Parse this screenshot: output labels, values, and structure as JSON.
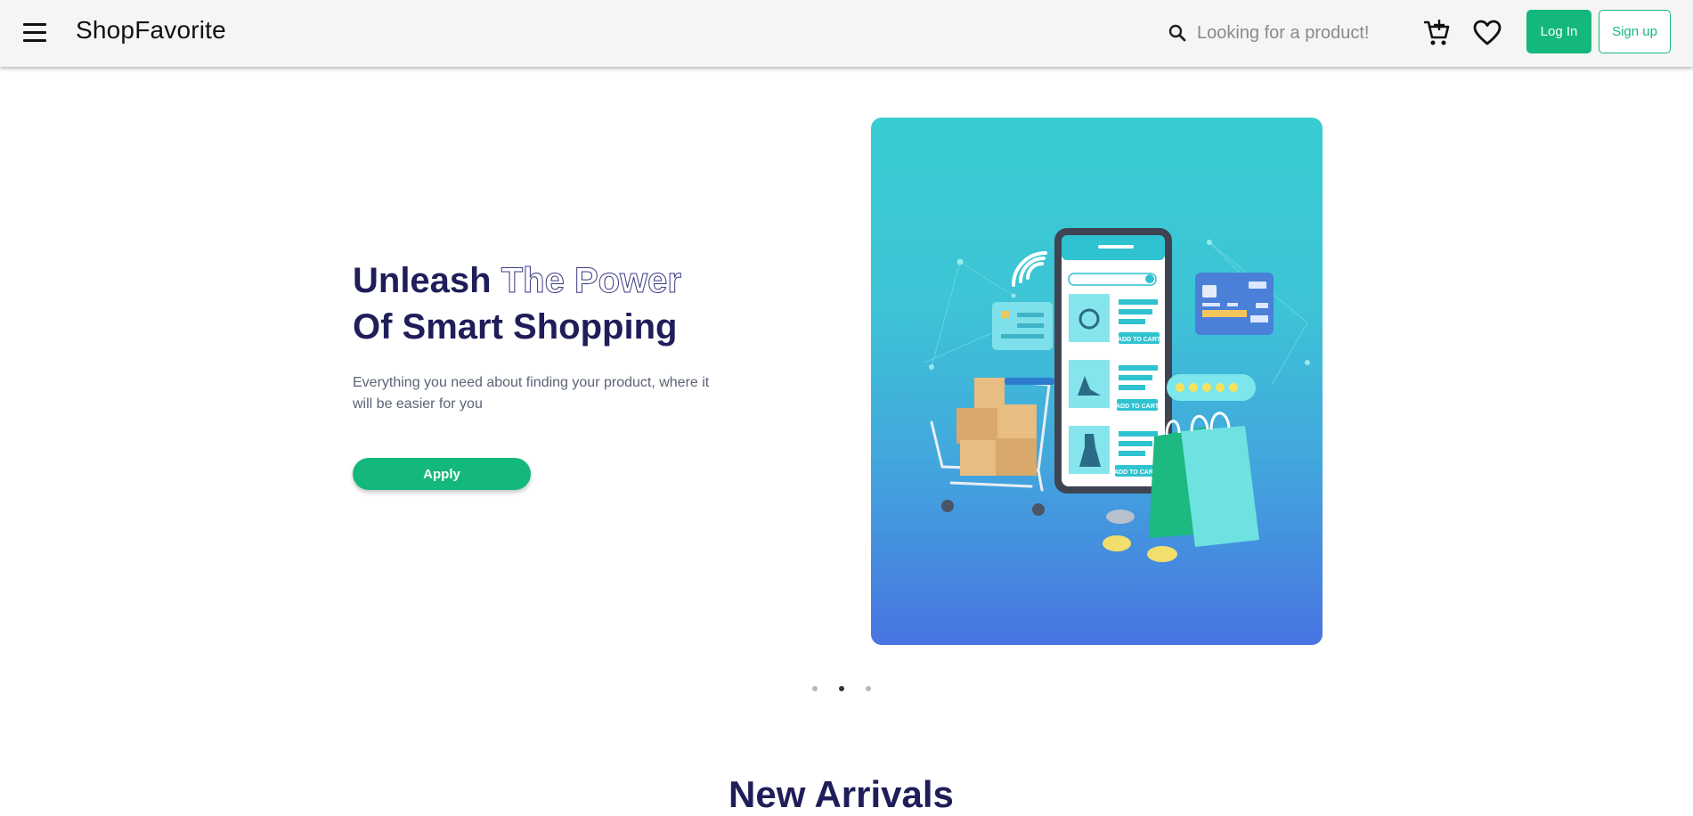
{
  "header": {
    "menu_icon": "hamburger-menu-icon",
    "brand": "ShopFavorite",
    "search": {
      "icon": "search-icon",
      "placeholder": "Looking for a product!"
    },
    "cart_icon": "cart-icon",
    "favorites_icon": "heart-icon",
    "login_label": "Log In",
    "signup_label": "Sign up"
  },
  "hero": {
    "title_part1": "Unleash ",
    "title_outline": "The Power",
    "title_line2": "Of Smart Shopping",
    "description": "Everything you need about finding your product, where it will be easier for you",
    "apply_label": "Apply",
    "illustration": {
      "phone_buttons": [
        "ADD TO CART",
        "ADD TO CART",
        "ADD TO CART"
      ]
    }
  },
  "carousel": {
    "active_index": 1,
    "slides": 3
  },
  "section": {
    "title": "New Arrivals"
  },
  "colors": {
    "accent": "#14b87c",
    "heading": "#1f1e5a",
    "hero_gradient_top": "#38cdd1",
    "hero_gradient_bottom": "#4874e1"
  }
}
